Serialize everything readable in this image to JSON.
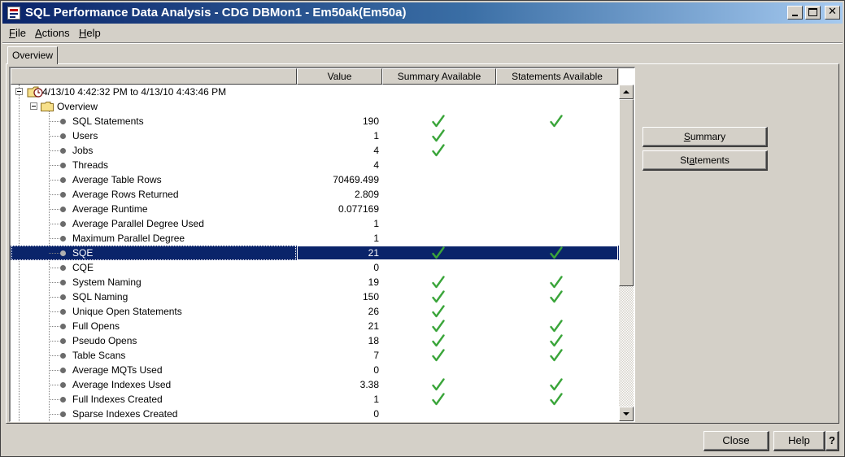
{
  "window": {
    "title": "SQL Performance Data Analysis - CDG DBMon1 - Em50ak(Em50a)"
  },
  "menu": {
    "file": {
      "pre": "",
      "mnemonic": "F",
      "post": "ile"
    },
    "actions": {
      "pre": "",
      "mnemonic": "A",
      "post": "ctions"
    },
    "help": {
      "pre": "",
      "mnemonic": "H",
      "post": "elp"
    }
  },
  "tab": {
    "overview": "Overview"
  },
  "table": {
    "headers": {
      "tree": "",
      "value": "Value",
      "summary": "Summary Available",
      "statements": "Statements Available"
    },
    "root": {
      "label": "4/13/10 4:42:32 PM  to  4/13/10 4:43:46 PM"
    },
    "group": {
      "label": "Overview"
    },
    "rows": [
      {
        "label": "SQL Statements",
        "value": "190",
        "summary": true,
        "statements": true
      },
      {
        "label": "Users",
        "value": "1",
        "summary": true,
        "statements": false
      },
      {
        "label": "Jobs",
        "value": "4",
        "summary": true,
        "statements": false
      },
      {
        "label": "Threads",
        "value": "4",
        "summary": false,
        "statements": false
      },
      {
        "label": "Average Table Rows",
        "value": "70469.499",
        "summary": false,
        "statements": false
      },
      {
        "label": "Average Rows Returned",
        "value": "2.809",
        "summary": false,
        "statements": false
      },
      {
        "label": "Average Runtime",
        "value": "0.077169",
        "summary": false,
        "statements": false
      },
      {
        "label": "Average Parallel Degree Used",
        "value": "1",
        "summary": false,
        "statements": false
      },
      {
        "label": "Maximum Parallel Degree",
        "value": "1",
        "summary": false,
        "statements": false
      },
      {
        "label": "SQE",
        "value": "21",
        "summary": true,
        "statements": true,
        "selected": true
      },
      {
        "label": "CQE",
        "value": "0",
        "summary": false,
        "statements": false
      },
      {
        "label": "System Naming",
        "value": "19",
        "summary": true,
        "statements": true
      },
      {
        "label": "SQL Naming",
        "value": "150",
        "summary": true,
        "statements": true
      },
      {
        "label": "Unique Open Statements",
        "value": "26",
        "summary": true,
        "statements": false
      },
      {
        "label": "Full Opens",
        "value": "21",
        "summary": true,
        "statements": true
      },
      {
        "label": "Pseudo Opens",
        "value": "18",
        "summary": true,
        "statements": true
      },
      {
        "label": "Table Scans",
        "value": "7",
        "summary": true,
        "statements": true
      },
      {
        "label": "Average MQTs Used",
        "value": "0",
        "summary": false,
        "statements": false
      },
      {
        "label": "Average Indexes Used",
        "value": "3.38",
        "summary": true,
        "statements": true
      },
      {
        "label": "Full Indexes Created",
        "value": "1",
        "summary": true,
        "statements": true
      },
      {
        "label": "Sparse Indexes Created",
        "value": "0",
        "summary": false,
        "statements": false
      }
    ]
  },
  "buttons": {
    "summary": {
      "pre": "",
      "mnemonic": "S",
      "post": "ummary"
    },
    "statements": {
      "pre": "St",
      "mnemonic": "a",
      "post": "tements"
    },
    "close": "Close",
    "help": "Help",
    "question": "?"
  },
  "colors": {
    "selection": "#0a246a",
    "check": "#3aa53a",
    "face": "#d4d0c8"
  },
  "icons": {
    "check": "check-icon",
    "folder": "folder-icon",
    "bullet": "bullet-icon"
  }
}
